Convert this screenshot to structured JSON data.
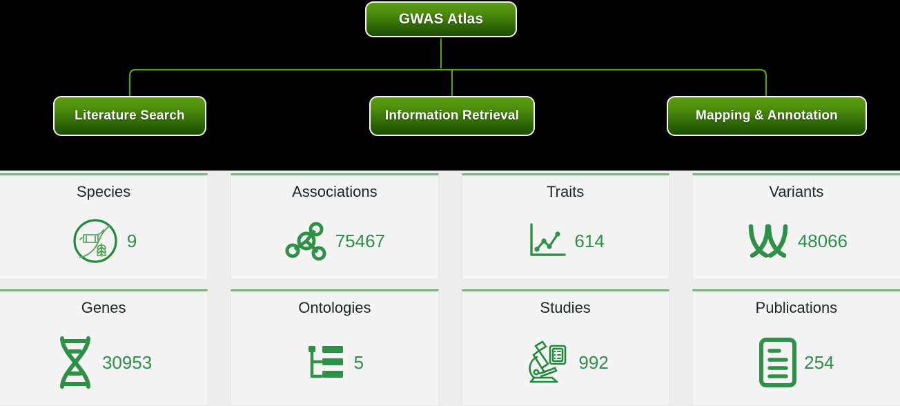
{
  "header": {
    "root": {
      "label": "GWAS Atlas",
      "icon": "root-node"
    },
    "children": [
      {
        "label": "Literature Search",
        "icon": "literature-search-node"
      },
      {
        "label": "Information Retrieval",
        "icon": "information-retrieval-node"
      },
      {
        "label": "Mapping & Annotation",
        "icon": "mapping-annotation-node"
      }
    ],
    "background_color": "#000000",
    "node_gradient_top": "#5a9b10",
    "node_gradient_bottom": "#1d4e03",
    "connector_color": "#5fa30a"
  },
  "stats": {
    "accent_color": "#2f9147",
    "card_top_border_color": "#74b474",
    "card_background": "#f4f4f4",
    "page_background": "#ededed",
    "cards": [
      {
        "title": "Species",
        "value": "9",
        "icon": "species-circle-icon"
      },
      {
        "title": "Associations",
        "value": "75467",
        "icon": "network-nodes-icon"
      },
      {
        "title": "Traits",
        "value": "614",
        "icon": "line-chart-icon"
      },
      {
        "title": "Variants",
        "value": "48066",
        "icon": "chromosome-cross-icon"
      },
      {
        "title": "Genes",
        "value": "30953",
        "icon": "dna-helix-icon"
      },
      {
        "title": "Ontologies",
        "value": "5",
        "icon": "hierarchy-list-icon"
      },
      {
        "title": "Studies",
        "value": "992",
        "icon": "microscope-icon"
      },
      {
        "title": "Publications",
        "value": "254",
        "icon": "document-page-icon"
      }
    ]
  }
}
